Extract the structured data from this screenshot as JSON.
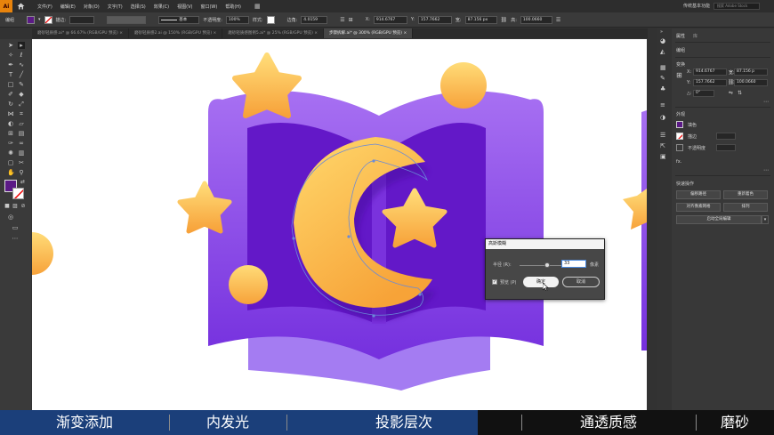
{
  "app": {
    "logo": "Ai",
    "workspace": "传统基本功能",
    "search_placeholder": "搜索 Adobe Stock"
  },
  "menu": [
    "文件(F)",
    "编辑(E)",
    "对象(O)",
    "文字(T)",
    "选择(S)",
    "效果(C)",
    "视图(V)",
    "窗口(W)",
    "帮助(H)"
  ],
  "controlbar": {
    "selection": "编组",
    "stroke_label": "描边:",
    "stroke_weight": "",
    "profile": "基本",
    "opacity_label": "不透明度:",
    "opacity_value": "100%",
    "style_label": "样式:",
    "x_label": "X:",
    "x_value": "914.6767",
    "y_label": "Y:",
    "y_value": "157.7662",
    "w_label": "宽:",
    "w_value": "87.156 px",
    "h_label": "高:",
    "h_value": "100.0660",
    "angle_label": "边角:",
    "angle_value": "4.0159",
    "fill_color": "#5b1a86"
  },
  "tabs": [
    {
      "label": "磨砂轻质感.ai* @ 66.67% (RGB/GPU 预览)",
      "active": false
    },
    {
      "label": "磨砂轻质感2.ai @ 150% (RGB/GPU 预览)",
      "active": false
    },
    {
      "label": "磨砂轻质感图例5.ai* @ 25% (RGB/GPU 预览)",
      "active": false
    },
    {
      "label": "步骤拆解.ai* @ 300% (RGB/GPU 预览)",
      "active": true
    }
  ],
  "properties": {
    "tab_properties": "属性",
    "tab_library": "库",
    "group_label": "编组",
    "transform_label": "变换",
    "x_label": "X:",
    "x_value": "914.6767",
    "y_label": "Y:",
    "y_value": "157.7662",
    "w_label": "宽:",
    "w_value": "87.156 p",
    "h_label": "高:",
    "h_value": "100.0660",
    "angle_label": "△:",
    "angle_value": "0°",
    "appearance_label": "外观",
    "fill_label": "填色",
    "stroke_label": "描边",
    "opacity_label": "不透明度",
    "fx_label": "fx.",
    "quick_label": "快速操作",
    "btn_offset_path": "偏移路径",
    "btn_recolor": "重新着色",
    "btn_align_pixel": "对齐像素网格",
    "btn_arrange": "排列",
    "btn_global_edit": "启动全局编辑",
    "fill_color": "#5b1a86"
  },
  "dialog": {
    "title": "高斯模糊",
    "radius_label": "半径 (R):",
    "radius_value": "33",
    "unit": "像素",
    "preview_label": "预览 (P)",
    "ok_label": "确定",
    "cancel_label": "取消",
    "slider_level": 0.62
  },
  "subtitles": [
    "渐变添加",
    "内发光",
    "投影层次",
    "通透质感",
    "磨砂"
  ],
  "colors": {
    "book_light": "#a36cf0",
    "book_dark": "#7b2fe0",
    "gold_light": "#ffd36b",
    "gold_dark": "#f9a438",
    "subtitle_highlight": "#1b3f7a"
  }
}
